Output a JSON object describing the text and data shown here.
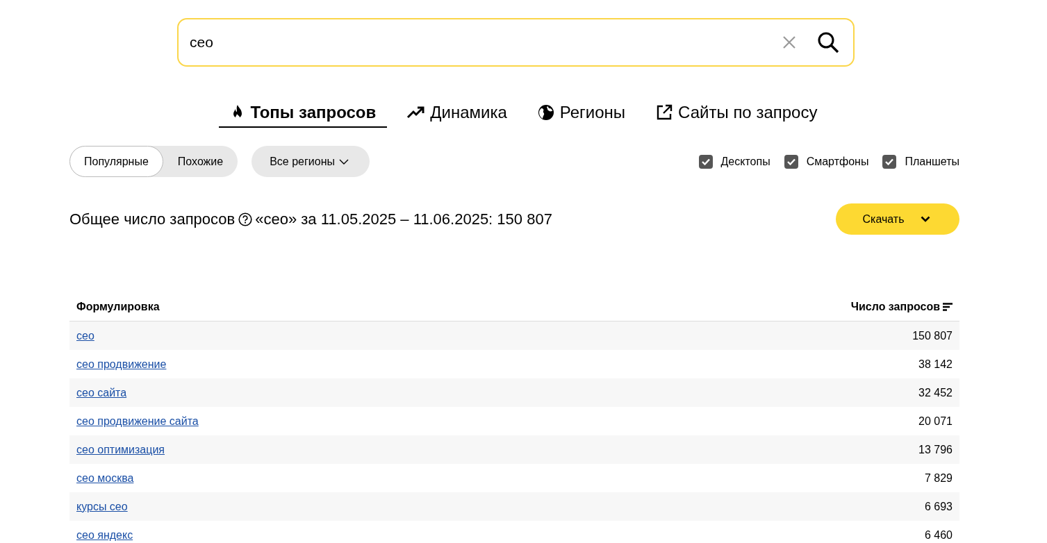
{
  "search": {
    "value": "сео"
  },
  "tabs": [
    {
      "label": "Топы запросов",
      "selected": true
    },
    {
      "label": "Динамика",
      "selected": false
    },
    {
      "label": "Регионы",
      "selected": false
    },
    {
      "label": "Сайты по запросу",
      "selected": false
    }
  ],
  "mode_switch": [
    {
      "label": "Популярные",
      "selected": true
    },
    {
      "label": "Похожие",
      "selected": false
    }
  ],
  "region_dropdown": {
    "label": "Все регионы"
  },
  "devices": [
    {
      "label": "Десктопы",
      "checked": true
    },
    {
      "label": "Смартфоны",
      "checked": true
    },
    {
      "label": "Планшеты",
      "checked": true
    }
  ],
  "summary": {
    "label": "Общее число запросов",
    "text": "«сео» за 11.05.2025 – 11.06.2025: 150 807"
  },
  "download_button": {
    "label": "Скачать"
  },
  "table": {
    "columns": [
      "Формулировка",
      "Число запросов"
    ],
    "rows": [
      {
        "phrase": "сео",
        "count": "150 807"
      },
      {
        "phrase": "сео продвижение",
        "count": "38 142"
      },
      {
        "phrase": "сео сайта",
        "count": "32 452"
      },
      {
        "phrase": "сео продвижение сайта",
        "count": "20 071"
      },
      {
        "phrase": "сео оптимизация",
        "count": "13 796"
      },
      {
        "phrase": "сео москва",
        "count": "7 829"
      },
      {
        "phrase": "курсы сео",
        "count": "6 693"
      },
      {
        "phrase": "сео яндекс",
        "count": "6 460"
      }
    ]
  }
}
